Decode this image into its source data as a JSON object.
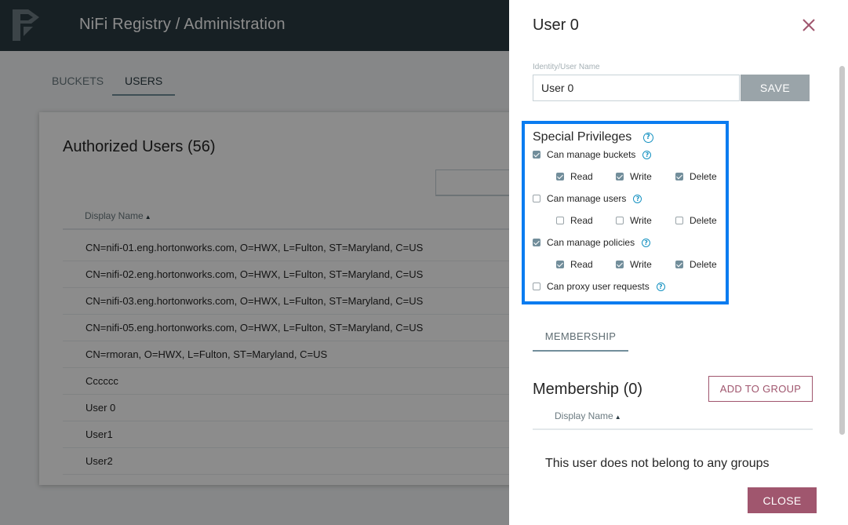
{
  "header": {
    "title": "NiFi Registry / Administration"
  },
  "tabs": [
    {
      "label": "BUCKETS"
    },
    {
      "label": "USERS"
    }
  ],
  "users_card": {
    "title": "Authorized Users (56)",
    "column_display_name": "Display Name",
    "rows": [
      "CN=nifi-01.eng.hortonworks.com, O=HWX, L=Fulton, ST=Maryland, C=US",
      "CN=nifi-02.eng.hortonworks.com, O=HWX, L=Fulton, ST=Maryland, C=US",
      "CN=nifi-03.eng.hortonworks.com, O=HWX, L=Fulton, ST=Maryland, C=US",
      "CN=nifi-05.eng.hortonworks.com, O=HWX, L=Fulton, ST=Maryland, C=US",
      "CN=rmoran, O=HWX, L=Fulton, ST=Maryland, C=US",
      "Cccccc",
      "User 0",
      "User1",
      "User2"
    ]
  },
  "panel": {
    "title": "User 0",
    "identity_label": "Identity/User Name",
    "identity_value": "User 0",
    "save_label": "SAVE",
    "special_privileges": {
      "title": "Special Privileges",
      "manage_buckets": {
        "label": "Can manage buckets",
        "checked": true
      },
      "manage_users": {
        "label": "Can manage users",
        "checked": false
      },
      "manage_policies": {
        "label": "Can manage policies",
        "checked": true
      },
      "proxy": {
        "label": "Can proxy user requests",
        "checked": false
      },
      "sub_labels": {
        "read": "Read",
        "write": "Write",
        "delete": "Delete"
      }
    },
    "membership_tab": "MEMBERSHIP",
    "membership_title": "Membership (0)",
    "add_to_group_label": "ADD TO GROUP",
    "membership_column": "Display Name",
    "empty_message": "This user does not belong to any groups",
    "close_label": "CLOSE"
  },
  "colors": {
    "header_bg": "#2b3b42",
    "accent_muted": "#728e9b",
    "action_rose": "#a0566e",
    "highlight_blue": "#0a7cf0",
    "help_blue": "#1491c1"
  },
  "icons": [
    "nifi-registry-logo-icon",
    "close-icon",
    "help-icon",
    "sort-ascending-icon",
    "checkbox-icon"
  ]
}
